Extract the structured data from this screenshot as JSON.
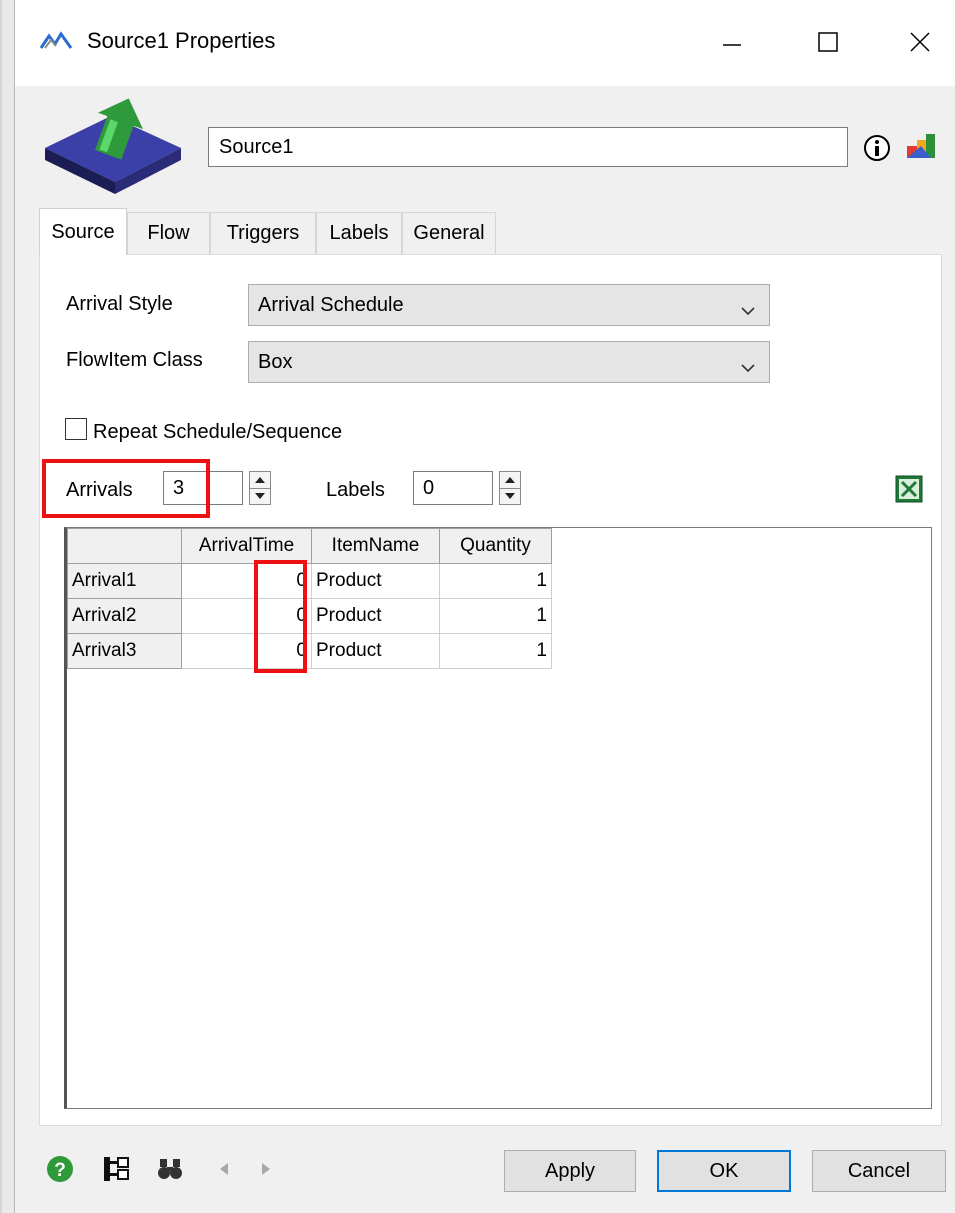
{
  "window": {
    "title": "Source1  Properties",
    "object_name": "Source1"
  },
  "tabs": [
    {
      "label": "Source",
      "active": true
    },
    {
      "label": "Flow",
      "active": false
    },
    {
      "label": "Triggers",
      "active": false
    },
    {
      "label": "Labels",
      "active": false
    },
    {
      "label": "General",
      "active": false
    }
  ],
  "source": {
    "arrival_style_label": "Arrival Style",
    "arrival_style_value": "Arrival Schedule",
    "flowitem_class_label": "FlowItem Class",
    "flowitem_class_value": "Box",
    "repeat_label": "Repeat Schedule/Sequence",
    "repeat_checked": false,
    "arrivals_label": "Arrivals",
    "arrivals_value": "3",
    "labels_label": "Labels",
    "labels_value": "0"
  },
  "table": {
    "columns": [
      "",
      "ArrivalTime",
      "ItemName",
      "Quantity"
    ],
    "rows": [
      {
        "name": "Arrival1",
        "time": "0",
        "item": "Product",
        "qty": "1"
      },
      {
        "name": "Arrival2",
        "time": "0",
        "item": "Product",
        "qty": "1"
      },
      {
        "name": "Arrival3",
        "time": "0",
        "item": "Product",
        "qty": "1"
      }
    ]
  },
  "buttons": {
    "apply": "Apply",
    "ok": "OK",
    "cancel": "Cancel"
  },
  "icons": {
    "title": "flexsim-logo-icon",
    "header": "source-object-icon",
    "info": "info-icon",
    "extra": "properties-extra-icon",
    "excel": "excel-icon",
    "help": "help-icon",
    "tree": "tree-icon",
    "find": "binoculars-icon",
    "prev": "previous-icon",
    "next": "next-icon"
  },
  "colors": {
    "highlight": "#ee1111",
    "accent": "#0078d7"
  }
}
